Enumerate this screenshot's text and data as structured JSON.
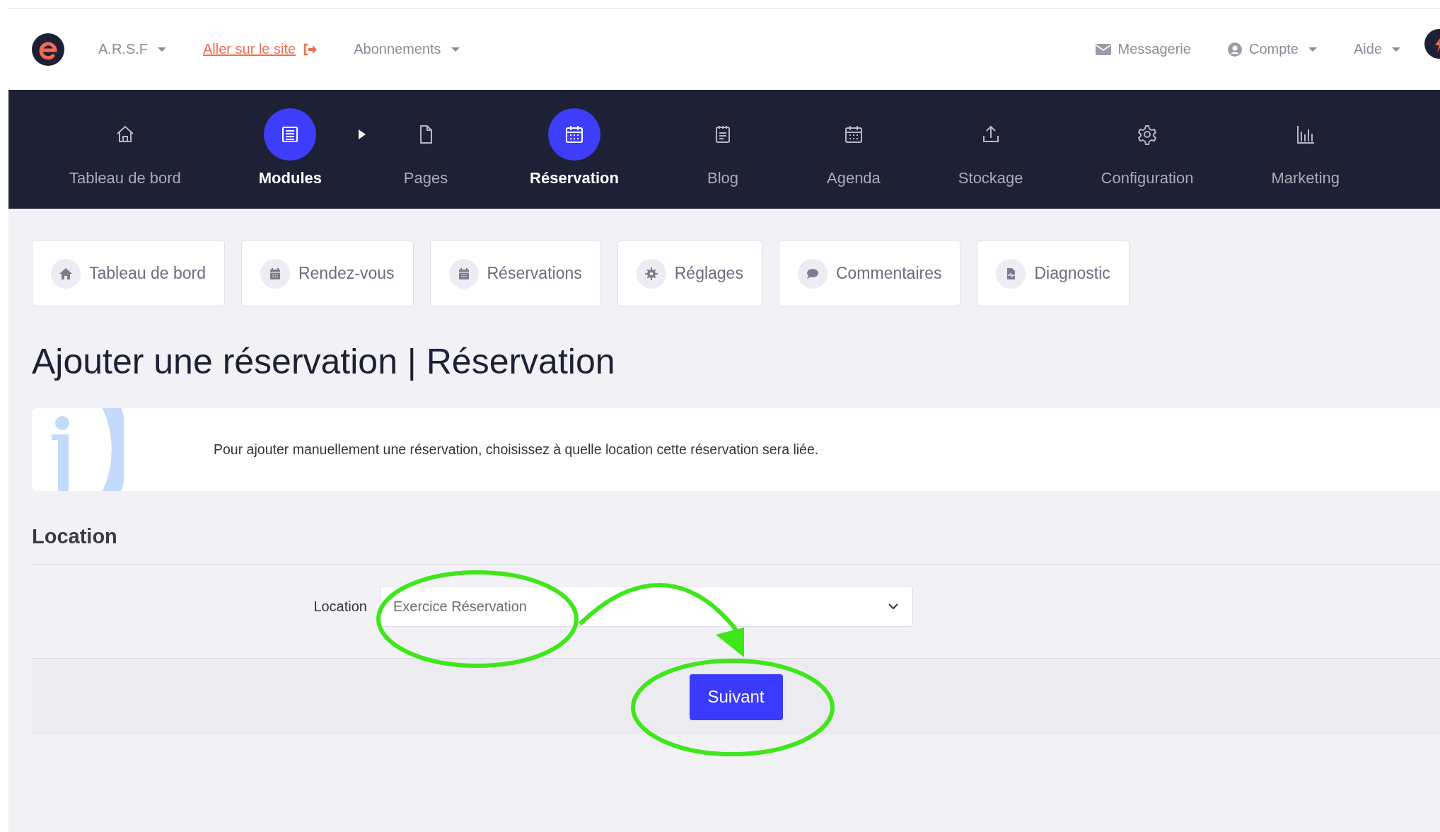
{
  "topbar": {
    "org": "A.R.S.F",
    "site_link": "Aller sur le site",
    "subscriptions": "Abonnements",
    "messages": "Messagerie",
    "account": "Compte",
    "help": "Aide"
  },
  "main_nav": [
    {
      "label": "Tableau de bord",
      "selected": false,
      "expanded": false
    },
    {
      "label": "Modules",
      "selected": true,
      "expanded": true
    },
    {
      "label": "Pages",
      "selected": false,
      "expanded": false
    },
    {
      "label": "Réservation",
      "selected": true,
      "expanded": false
    },
    {
      "label": "Blog",
      "selected": false,
      "expanded": false
    },
    {
      "label": "Agenda",
      "selected": false,
      "expanded": false
    },
    {
      "label": "Stockage",
      "selected": false,
      "expanded": false
    },
    {
      "label": "Configuration",
      "selected": false,
      "expanded": false
    },
    {
      "label": "Marketing",
      "selected": false,
      "expanded": false
    }
  ],
  "sub_tabs": [
    "Tableau de bord",
    "Rendez-vous",
    "Réservations",
    "Réglages",
    "Commentaires",
    "Diagnostic"
  ],
  "title": "Ajouter une réservation | Réservation",
  "info": "Pour ajouter manuellement une réservation, choisissez à quelle location cette réservation sera liée.",
  "section": {
    "title": "Location",
    "field_label": "Location",
    "value": "Exercice Réservation"
  },
  "submit": "Suivant"
}
